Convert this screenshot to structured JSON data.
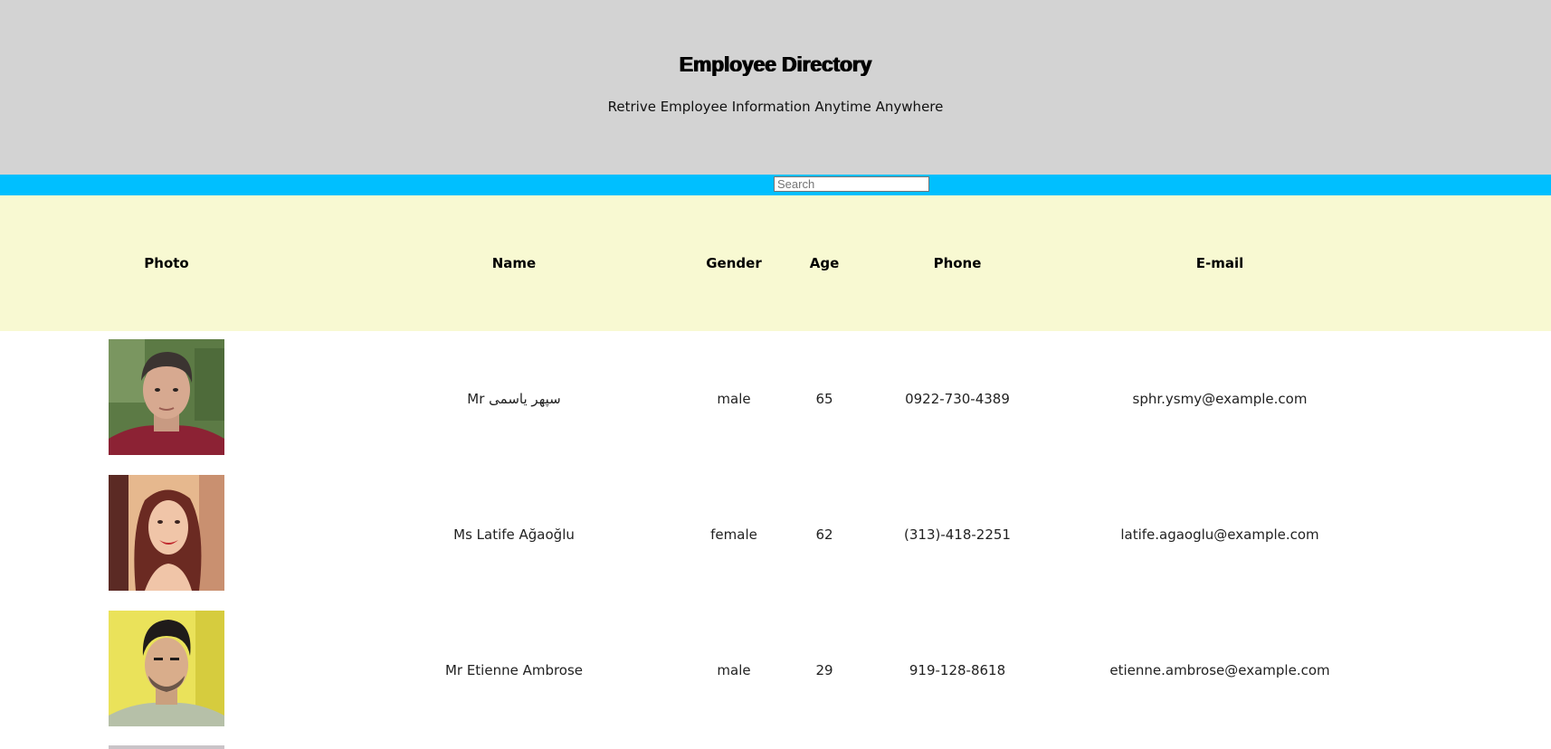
{
  "header": {
    "title": "Employee Directory",
    "subtitle": "Retrive Employee Information Anytime Anywhere"
  },
  "search": {
    "placeholder": "Search",
    "value": ""
  },
  "table": {
    "columns": [
      "Photo",
      "Name",
      "Gender",
      "Age",
      "Phone",
      "E-mail"
    ],
    "rows": [
      {
        "name": "Mr سپهر یاسمی",
        "gender": "male",
        "age": "65",
        "phone": "0922-730-4389",
        "email": "sphr.ysmy@example.com"
      },
      {
        "name": "Ms Latife Ağaoğlu",
        "gender": "female",
        "age": "62",
        "phone": "(313)-418-2251",
        "email": "latife.agaoglu@example.com"
      },
      {
        "name": "Mr Etienne Ambrose",
        "gender": "male",
        "age": "29",
        "phone": "919-128-8618",
        "email": "etienne.ambrose@example.com"
      }
    ]
  },
  "colors": {
    "header_bg": "#d3d3d3",
    "search_bar_bg": "#00bfff",
    "table_header_bg": "#f8f9d2"
  }
}
